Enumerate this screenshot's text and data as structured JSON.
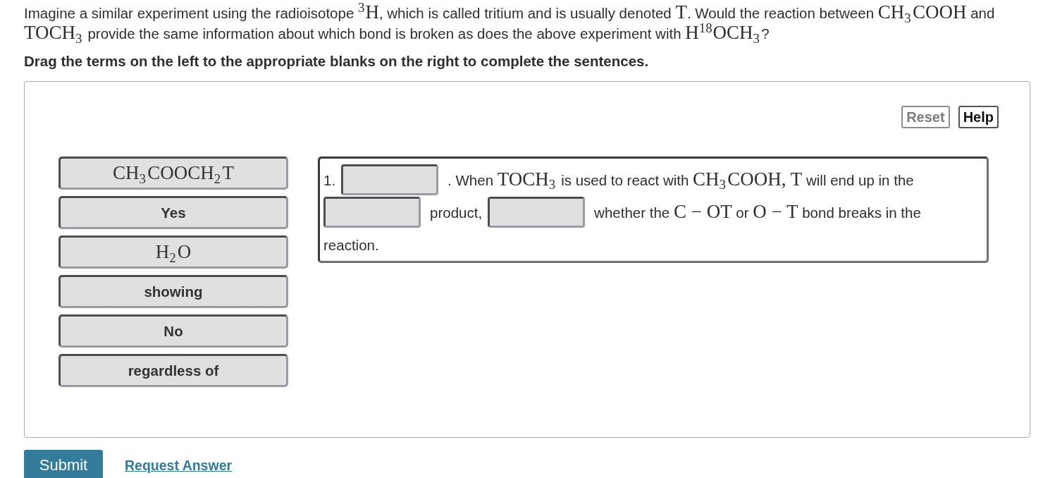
{
  "question": {
    "segments": [
      {
        "kind": "text",
        "text": "Imagine a similar experiment using the radioisotope "
      },
      {
        "kind": "math",
        "text": "$^{3}$H"
      },
      {
        "kind": "text",
        "text": ", which is called tritium and is usually denoted "
      },
      {
        "kind": "math",
        "text": "T"
      },
      {
        "kind": "text",
        "text": ". Would the reaction between "
      },
      {
        "kind": "math",
        "text": "CH$_{3}$COOH"
      },
      {
        "kind": "text",
        "text": " and "
      },
      {
        "kind": "math",
        "text": "TOCH$_{3}$"
      },
      {
        "kind": "text",
        "text": " provide the same information about which bond is broken as does the above experiment with "
      },
      {
        "kind": "math",
        "text": "H$^{18}$OCH$_{3}$"
      },
      {
        "kind": "text",
        "text": "?"
      }
    ]
  },
  "instruction": "Drag the terms on the left to the appropriate blanks on the right to complete the sentences.",
  "panel": {
    "buttons": [
      {
        "label": "Reset",
        "disabled": true
      },
      {
        "label": "Help",
        "disabled": false
      }
    ],
    "terms": [
      {
        "kind": "math",
        "text": "CH$_{3}$COOCH$_{2}$T"
      },
      {
        "kind": "word",
        "text": "Yes"
      },
      {
        "kind": "math",
        "text": "H$_{2}$O"
      },
      {
        "kind": "word",
        "text": "showing"
      },
      {
        "kind": "word",
        "text": "No"
      },
      {
        "kind": "word",
        "text": "regardless of"
      }
    ],
    "drop_zone": {
      "lines": [
        {
          "parts": [
            {
              "kind": "text",
              "segments": [
                {
                  "kind": "text",
                  "text": "1."
                }
              ]
            },
            {
              "kind": "blank"
            },
            {
              "kind": "text",
              "segments": [
                {
                  "kind": "text",
                  "text": ". When "
                },
                {
                  "kind": "math",
                  "text": "TOCH$_{3}$"
                },
                {
                  "kind": "text",
                  "text": " is used to react with "
                },
                {
                  "kind": "math",
                  "text": "CH$_{3}$COOH,"
                },
                {
                  "kind": "math",
                  "text": " T"
                },
                {
                  "kind": "text",
                  "text": " will end up in the"
                }
              ]
            }
          ]
        },
        {
          "parts": [
            {
              "kind": "blank"
            },
            {
              "kind": "text",
              "segments": [
                {
                  "kind": "text",
                  "text": "product,"
                }
              ]
            },
            {
              "kind": "blank"
            },
            {
              "kind": "text",
              "segments": [
                {
                  "kind": "text",
                  "text": "whether the "
                },
                {
                  "kind": "math",
                  "text": "C − OT"
                },
                {
                  "kind": "text",
                  "text": " or "
                },
                {
                  "kind": "math",
                  "text": "O − T"
                },
                {
                  "kind": "text",
                  "text": " bond breaks in the"
                }
              ]
            }
          ]
        },
        {
          "parts": [
            {
              "kind": "text",
              "segments": [
                {
                  "kind": "text",
                  "text": "reaction."
                }
              ]
            }
          ]
        }
      ]
    }
  },
  "actions": {
    "submit": "Submit",
    "request_answer": "Request Answer"
  }
}
